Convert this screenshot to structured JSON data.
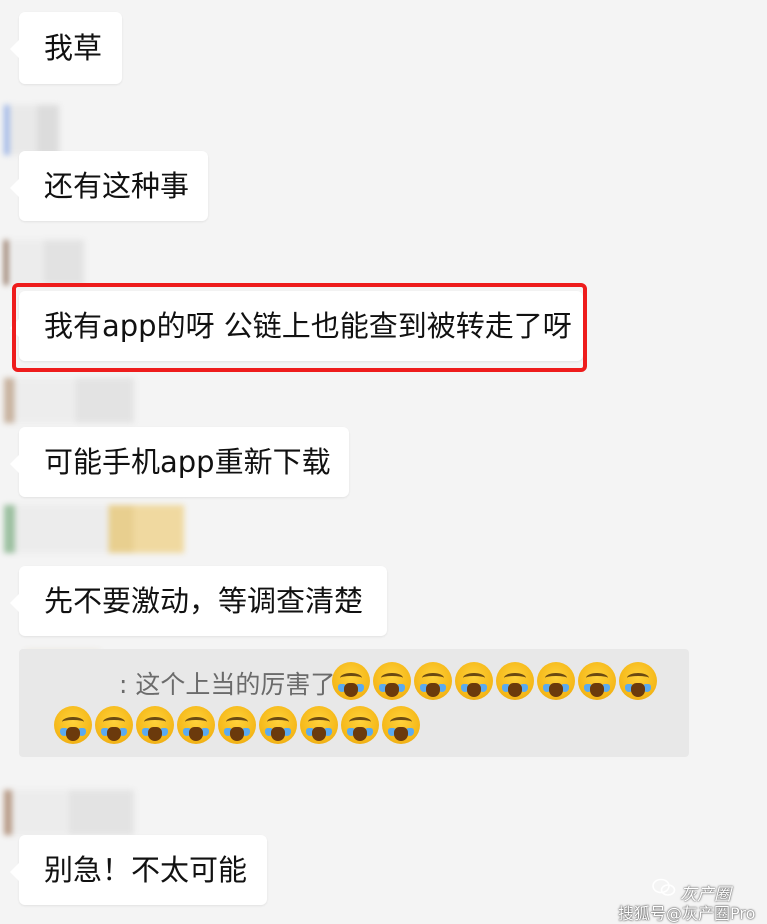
{
  "messages": [
    {
      "id": "m1",
      "text": "我草"
    },
    {
      "id": "m2",
      "text": "还有这种事"
    },
    {
      "id": "m3",
      "text": "我有app的呀 公链上也能查到被转走了呀"
    },
    {
      "id": "m4",
      "text": "可能手机app重新下载"
    },
    {
      "id": "m5",
      "text": "先不要激动，等调查清楚"
    },
    {
      "id": "m6",
      "text": "别急！不太可能"
    }
  ],
  "quote": {
    "text": ": 这个上当的厉害了",
    "emoji_icon": "loudly-crying-face-icon",
    "emoji_count_line1": 8,
    "emoji_count_line2": 9
  },
  "watermark": {
    "brand": "灰产圈",
    "source": "搜狐号@灰产圈Pro"
  },
  "colors": {
    "background": "#f4f4f4",
    "bubble": "#ffffff",
    "highlight_border": "#ee1c1c",
    "quote_background": "#e8e8e8"
  }
}
